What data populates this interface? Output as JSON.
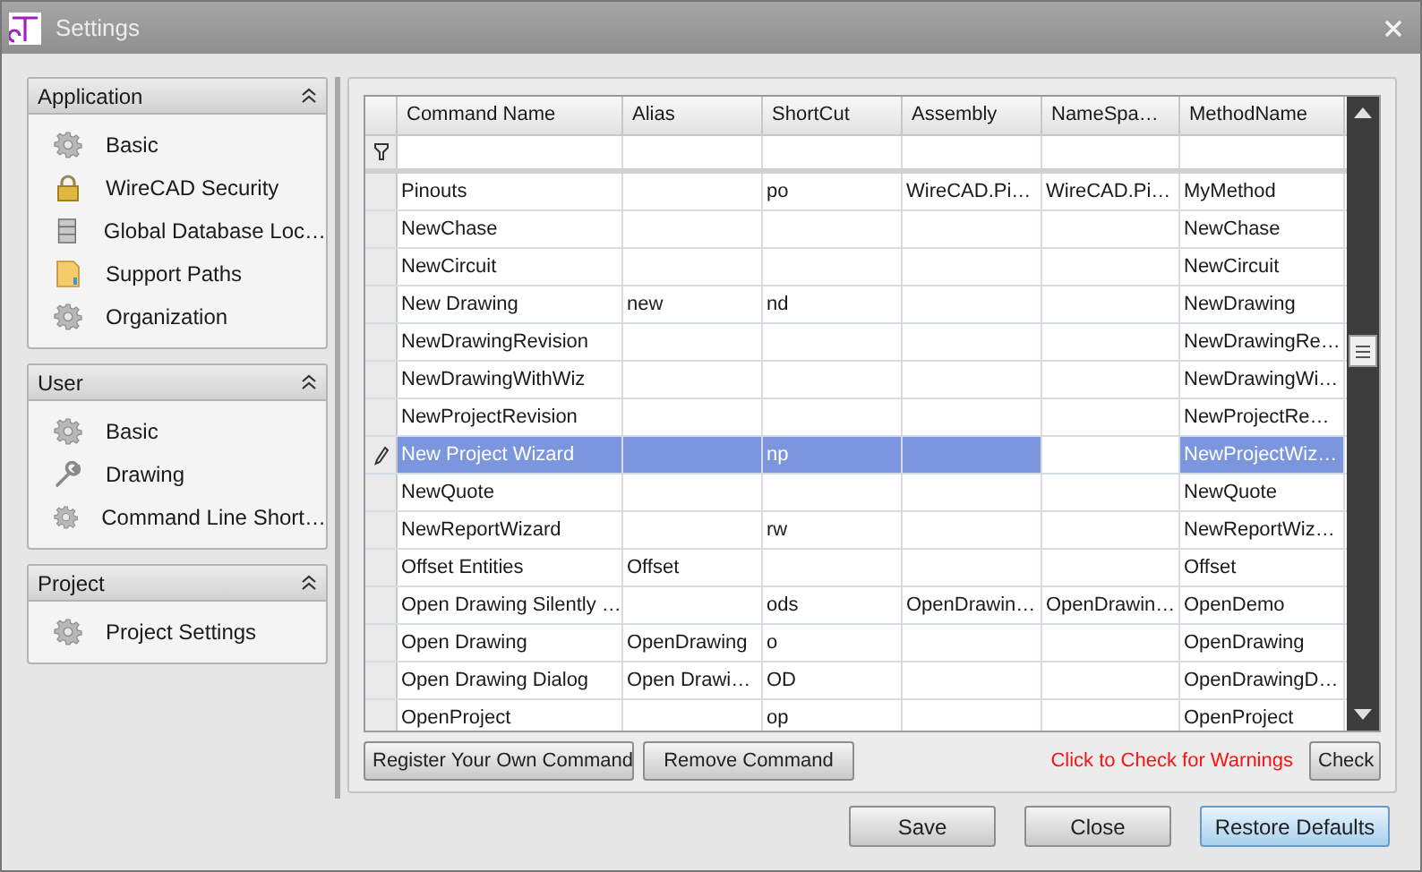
{
  "window": {
    "title": "Settings"
  },
  "sidebar": {
    "groups": [
      {
        "title": "Application",
        "expanded": true,
        "items": [
          {
            "label": "Basic",
            "kind": "gear"
          },
          {
            "label": "WireCAD Security",
            "kind": "lock"
          },
          {
            "label": "Global Database Loc…",
            "kind": "database"
          },
          {
            "label": "Support Paths",
            "kind": "folder"
          },
          {
            "label": "Organization",
            "kind": "gear"
          }
        ]
      },
      {
        "title": "User",
        "expanded": true,
        "items": [
          {
            "label": "Basic",
            "kind": "gear"
          },
          {
            "label": "Drawing",
            "kind": "wrench"
          },
          {
            "label": "Command Line Short…",
            "kind": "gear"
          }
        ]
      },
      {
        "title": "Project",
        "expanded": true,
        "items": [
          {
            "label": "Project Settings",
            "kind": "gear"
          }
        ]
      }
    ]
  },
  "table": {
    "columns": [
      {
        "label": "Command Name",
        "focused": false
      },
      {
        "label": "Alias",
        "focused": false
      },
      {
        "label": "ShortCut",
        "focused": false
      },
      {
        "label": "Assembly",
        "focused": false
      },
      {
        "label": "NameSpa…",
        "focused": true
      },
      {
        "label": "MethodName",
        "focused": false
      }
    ],
    "rows": [
      {
        "selected": false,
        "cells": [
          "Pinouts",
          "",
          "po",
          "WireCAD.Pi…",
          "WireCAD.Pi…",
          "MyMethod"
        ]
      },
      {
        "selected": false,
        "cells": [
          "NewChase",
          "",
          "",
          "",
          "",
          "NewChase"
        ]
      },
      {
        "selected": false,
        "cells": [
          "NewCircuit",
          "",
          "",
          "",
          "",
          "NewCircuit"
        ]
      },
      {
        "selected": false,
        "cells": [
          "New Drawing",
          "new",
          "nd",
          "",
          "",
          "NewDrawing"
        ]
      },
      {
        "selected": false,
        "cells": [
          "NewDrawingRevision",
          "",
          "",
          "",
          "",
          "NewDrawingRe…"
        ]
      },
      {
        "selected": false,
        "cells": [
          "NewDrawingWithWiz",
          "",
          "",
          "",
          "",
          "NewDrawingWi…"
        ]
      },
      {
        "selected": false,
        "cells": [
          "NewProjectRevision",
          "",
          "",
          "",
          "",
          "NewProjectRe…"
        ]
      },
      {
        "selected": true,
        "cells": [
          "New Project Wizard",
          "",
          "np",
          "",
          "",
          "NewProjectWiz…"
        ]
      },
      {
        "selected": false,
        "cells": [
          "NewQuote",
          "",
          "",
          "",
          "",
          "NewQuote"
        ]
      },
      {
        "selected": false,
        "cells": [
          "NewReportWizard",
          "",
          "rw",
          "",
          "",
          "NewReportWiz…"
        ]
      },
      {
        "selected": false,
        "cells": [
          "Offset Entities",
          "Offset",
          "",
          "",
          "",
          "Offset"
        ]
      },
      {
        "selected": false,
        "cells": [
          "Open Drawing Silently …",
          "",
          "ods",
          "OpenDrawin…",
          "OpenDrawin…",
          "OpenDemo"
        ]
      },
      {
        "selected": false,
        "cells": [
          "Open Drawing",
          "OpenDrawing",
          "o",
          "",
          "",
          "OpenDrawing"
        ]
      },
      {
        "selected": false,
        "cells": [
          "Open Drawing Dialog",
          "Open Drawi…",
          "OD",
          "",
          "",
          "OpenDrawingD…"
        ]
      },
      {
        "selected": false,
        "cells": [
          "OpenProject",
          "",
          "op",
          "",
          "",
          "OpenProject"
        ]
      }
    ]
  },
  "command_buttons": [
    "Register Your Own Command",
    "Remove Command"
  ],
  "warning": "Click to Check for Warnings",
  "check_button": "Check",
  "footer_buttons": [
    {
      "label": "Save",
      "default": false
    },
    {
      "label": "Close",
      "default": false
    },
    {
      "label": "Restore Defaults",
      "default": true
    }
  ]
}
